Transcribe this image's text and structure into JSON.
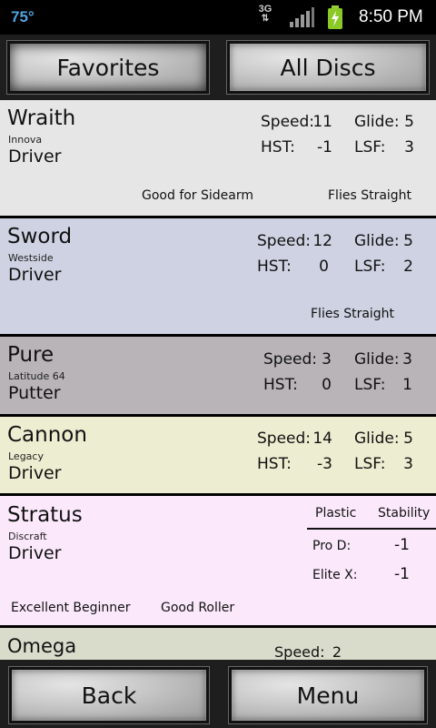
{
  "status_bar": {
    "temperature": "75°",
    "network": "3G",
    "time": "8:50 PM",
    "signal_icon": "signal-bars-icon",
    "battery_icon": "battery-charging-icon"
  },
  "tabs": {
    "favorites": "Favorites",
    "all_discs": "All Discs"
  },
  "discs": [
    {
      "name": "Wraith",
      "brand": "Innova",
      "type": "Driver",
      "speed_label": "Speed:",
      "speed": "11",
      "glide_label": "Glide:",
      "glide": "5",
      "hst_label": "HST:",
      "hst": "-1",
      "lsf_label": "LSF:",
      "lsf": "3",
      "tags": [
        "Good for Sidearm",
        "Flies Straight"
      ],
      "bg": "#e6e6e6"
    },
    {
      "name": "Sword",
      "brand": "Westside",
      "type": "Driver",
      "speed_label": "Speed:",
      "speed": "12",
      "glide_label": "Glide:",
      "glide": "5",
      "hst_label": "HST:",
      "hst": "0",
      "lsf_label": "LSF:",
      "lsf": "2",
      "tags": [
        "Flies Straight"
      ],
      "bg": "#ced2e2"
    },
    {
      "name": "Pure",
      "brand": "Latitude 64",
      "type": "Putter",
      "speed_label": "Speed:",
      "speed": "3",
      "glide_label": "Glide:",
      "glide": "3",
      "hst_label": "HST:",
      "hst": "0",
      "lsf_label": "LSF:",
      "lsf": "1",
      "tags": [],
      "bg": "#b8b4b8"
    },
    {
      "name": "Cannon",
      "brand": "Legacy",
      "type": "Driver",
      "speed_label": "Speed:",
      "speed": "14",
      "glide_label": "Glide:",
      "glide": "5",
      "hst_label": "HST:",
      "hst": "-3",
      "lsf_label": "LSF:",
      "lsf": "3",
      "tags": [],
      "bg": "#ededd2"
    },
    {
      "name": "Stratus",
      "brand": "Discraft",
      "type": "Driver",
      "plastic_header": "Plastic",
      "stability_header": "Stability",
      "plastics": [
        {
          "plastic": "Pro D:",
          "stability": "-1"
        },
        {
          "plastic": "Elite X:",
          "stability": "-1"
        }
      ],
      "tags": [
        "Excellent Beginner",
        "Good Roller"
      ],
      "bg": "#fbe9fb"
    },
    {
      "name": "Omega",
      "speed_label": "Speed:",
      "speed": "2",
      "bg": "#d9dccb"
    }
  ],
  "bottom": {
    "back": "Back",
    "menu": "Menu"
  }
}
